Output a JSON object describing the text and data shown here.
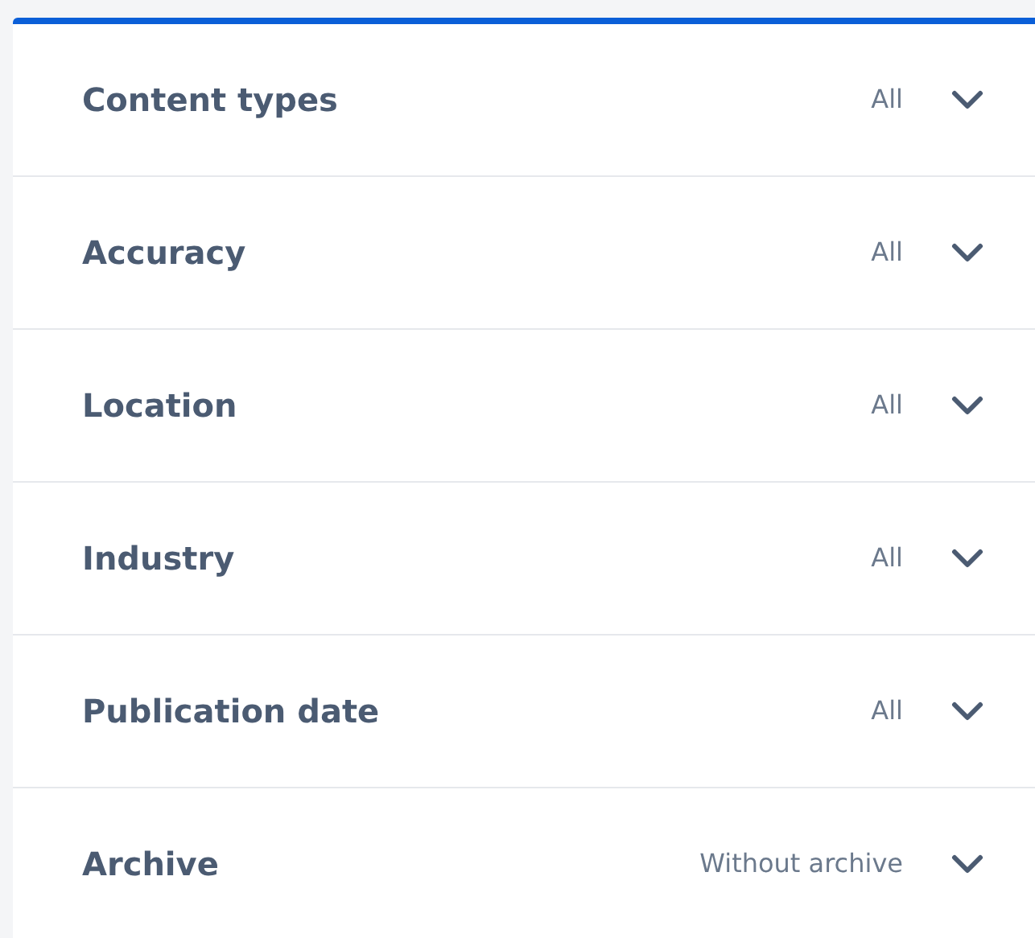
{
  "filters": [
    {
      "title": "Content types",
      "value": "All",
      "expanded": false
    },
    {
      "title": "Accuracy",
      "value": "All",
      "expanded": false
    },
    {
      "title": "Location",
      "value": "All",
      "expanded": false
    },
    {
      "title": "Industry",
      "value": "All",
      "expanded": false
    },
    {
      "title": "Publication date",
      "value": "All",
      "expanded": false
    },
    {
      "title": "Archive",
      "value": "Without archive",
      "expanded": false
    }
  ]
}
